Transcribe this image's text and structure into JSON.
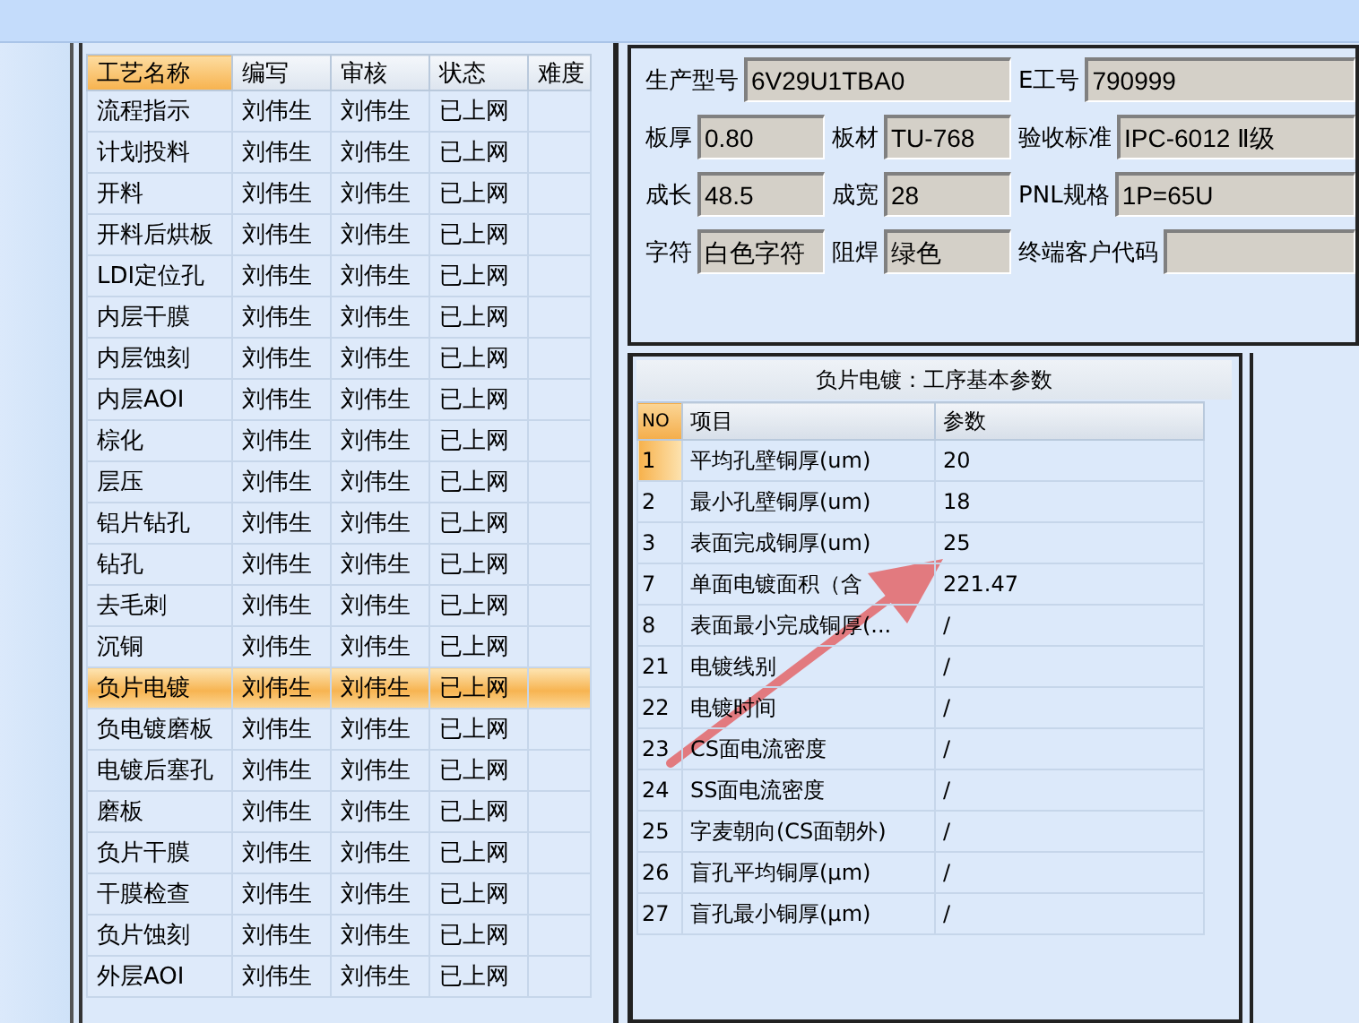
{
  "process_table": {
    "columns": [
      {
        "label": "工艺名称",
        "selected": true
      },
      {
        "label": "编写",
        "selected": false
      },
      {
        "label": "审核",
        "selected": false
      },
      {
        "label": "状态",
        "selected": false
      },
      {
        "label": "难度",
        "selected": false
      }
    ],
    "rows": [
      {
        "cells": [
          "流程指示",
          "刘伟生",
          "刘伟生",
          "已上网"
        ],
        "selected": false
      },
      {
        "cells": [
          "计划投料",
          "刘伟生",
          "刘伟生",
          "已上网"
        ],
        "selected": false
      },
      {
        "cells": [
          "开料",
          "刘伟生",
          "刘伟生",
          "已上网"
        ],
        "selected": false
      },
      {
        "cells": [
          "开料后烘板",
          "刘伟生",
          "刘伟生",
          "已上网"
        ],
        "selected": false
      },
      {
        "cells": [
          "LDI定位孔",
          "刘伟生",
          "刘伟生",
          "已上网"
        ],
        "selected": false
      },
      {
        "cells": [
          "内层干膜",
          "刘伟生",
          "刘伟生",
          "已上网"
        ],
        "selected": false
      },
      {
        "cells": [
          "内层蚀刻",
          "刘伟生",
          "刘伟生",
          "已上网"
        ],
        "selected": false
      },
      {
        "cells": [
          "内层AOI",
          "刘伟生",
          "刘伟生",
          "已上网"
        ],
        "selected": false
      },
      {
        "cells": [
          "棕化",
          "刘伟生",
          "刘伟生",
          "已上网"
        ],
        "selected": false
      },
      {
        "cells": [
          "层压",
          "刘伟生",
          "刘伟生",
          "已上网"
        ],
        "selected": false
      },
      {
        "cells": [
          "铝片钻孔",
          "刘伟生",
          "刘伟生",
          "已上网"
        ],
        "selected": false
      },
      {
        "cells": [
          "钻孔",
          "刘伟生",
          "刘伟生",
          "已上网"
        ],
        "selected": false
      },
      {
        "cells": [
          "去毛刺",
          "刘伟生",
          "刘伟生",
          "已上网"
        ],
        "selected": false
      },
      {
        "cells": [
          "沉铜",
          "刘伟生",
          "刘伟生",
          "已上网"
        ],
        "selected": false
      },
      {
        "cells": [
          "负片电镀",
          "刘伟生",
          "刘伟生",
          "已上网"
        ],
        "selected": true
      },
      {
        "cells": [
          "负电镀磨板",
          "刘伟生",
          "刘伟生",
          "已上网"
        ],
        "selected": false
      },
      {
        "cells": [
          "电镀后塞孔",
          "刘伟生",
          "刘伟生",
          "已上网"
        ],
        "selected": false
      },
      {
        "cells": [
          "磨板",
          "刘伟生",
          "刘伟生",
          "已上网"
        ],
        "selected": false
      },
      {
        "cells": [
          "负片干膜",
          "刘伟生",
          "刘伟生",
          "已上网"
        ],
        "selected": false
      },
      {
        "cells": [
          "干膜检查",
          "刘伟生",
          "刘伟生",
          "已上网"
        ],
        "selected": false
      },
      {
        "cells": [
          "负片蚀刻",
          "刘伟生",
          "刘伟生",
          "已上网"
        ],
        "selected": false
      },
      {
        "cells": [
          "外层AOI",
          "刘伟生",
          "刘伟生",
          "已上网"
        ],
        "selected": false
      }
    ]
  },
  "product_info": {
    "fields": [
      {
        "label": "生产型号",
        "value": "6V29U1TBA0"
      },
      {
        "label": "E工号",
        "value": "790999"
      },
      {
        "label": "板厚",
        "value": "0.80"
      },
      {
        "label": "板材",
        "value": "TU-768"
      },
      {
        "label": "验收标准",
        "value": "IPC-6012 Ⅱ级"
      },
      {
        "label": "成长",
        "value": "48.5"
      },
      {
        "label": "成宽",
        "value": "28"
      },
      {
        "label": "PNL规格",
        "value": "1P=65U"
      },
      {
        "label": "字符",
        "value": "白色字符"
      },
      {
        "label": "阻焊",
        "value": "绿色"
      },
      {
        "label": "终端客户代码"
      }
    ]
  },
  "params_panel": {
    "title": "负片电镀：工序基本参数",
    "columns": [
      "NO",
      "项目",
      "参数"
    ],
    "rows": [
      {
        "no": "1",
        "item": "平均孔壁铜厚(um)",
        "value": "20",
        "selected": true
      },
      {
        "no": "2",
        "item": "最小孔壁铜厚(um)",
        "value": "18",
        "selected": false
      },
      {
        "no": "3",
        "item": "表面完成铜厚(um)",
        "value": "25",
        "selected": false
      },
      {
        "no": "7",
        "item": "单面电镀面积（含",
        "value": "221.47",
        "selected": false
      },
      {
        "no": "8",
        "item": "表面最小完成铜厚(...",
        "value": "/",
        "selected": false
      },
      {
        "no": "21",
        "item": "电镀线别",
        "value": "/",
        "selected": false
      },
      {
        "no": "22",
        "item": "电镀时间",
        "value": "/",
        "selected": false
      },
      {
        "no": "23",
        "item": "CS面电流密度",
        "value": "/",
        "selected": false
      },
      {
        "no": "24",
        "item": "SS面电流密度",
        "value": "/",
        "selected": false
      },
      {
        "no": "25",
        "item": "字麦朝向(CS面朝外)",
        "value": "/",
        "selected": false
      },
      {
        "no": "26",
        "item": "盲孔平均铜厚(μm)",
        "value": "/",
        "selected": false
      },
      {
        "no": "27",
        "item": "盲孔最小铜厚(μm)",
        "value": "/",
        "selected": false
      }
    ]
  }
}
